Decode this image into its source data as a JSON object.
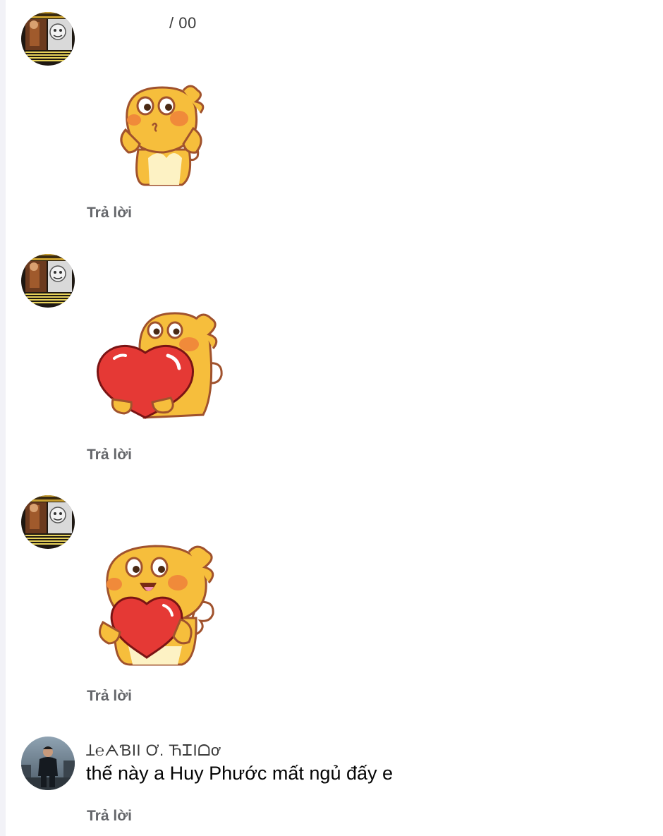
{
  "comments": [
    {
      "author": "/ 00",
      "sticker": "yellow-creature-waving-sticker",
      "reply_label": "Trả lời"
    },
    {
      "author": "",
      "sticker": "yellow-creature-hugging-big-heart-sticker",
      "reply_label": "Trả lời"
    },
    {
      "author": "",
      "sticker": "yellow-creature-holding-heart-sticker",
      "reply_label": "Trả lời"
    },
    {
      "author": "Ʇ℮ᗅƁII Ơ.         ЋᏆIᗝơ",
      "text": "thế này a Huy Phước mất ngủ đấy e",
      "reply_label": "Trả lời"
    }
  ],
  "colors": {
    "background": "#ffffff",
    "reply_text": "#65676b",
    "comment_text": "#050505",
    "creature_body": "#f6be3c",
    "creature_outline": "#a0522d",
    "heart": "#e53935"
  },
  "icons": [
    "avatar-anime-collage",
    "avatar-person-photo"
  ]
}
